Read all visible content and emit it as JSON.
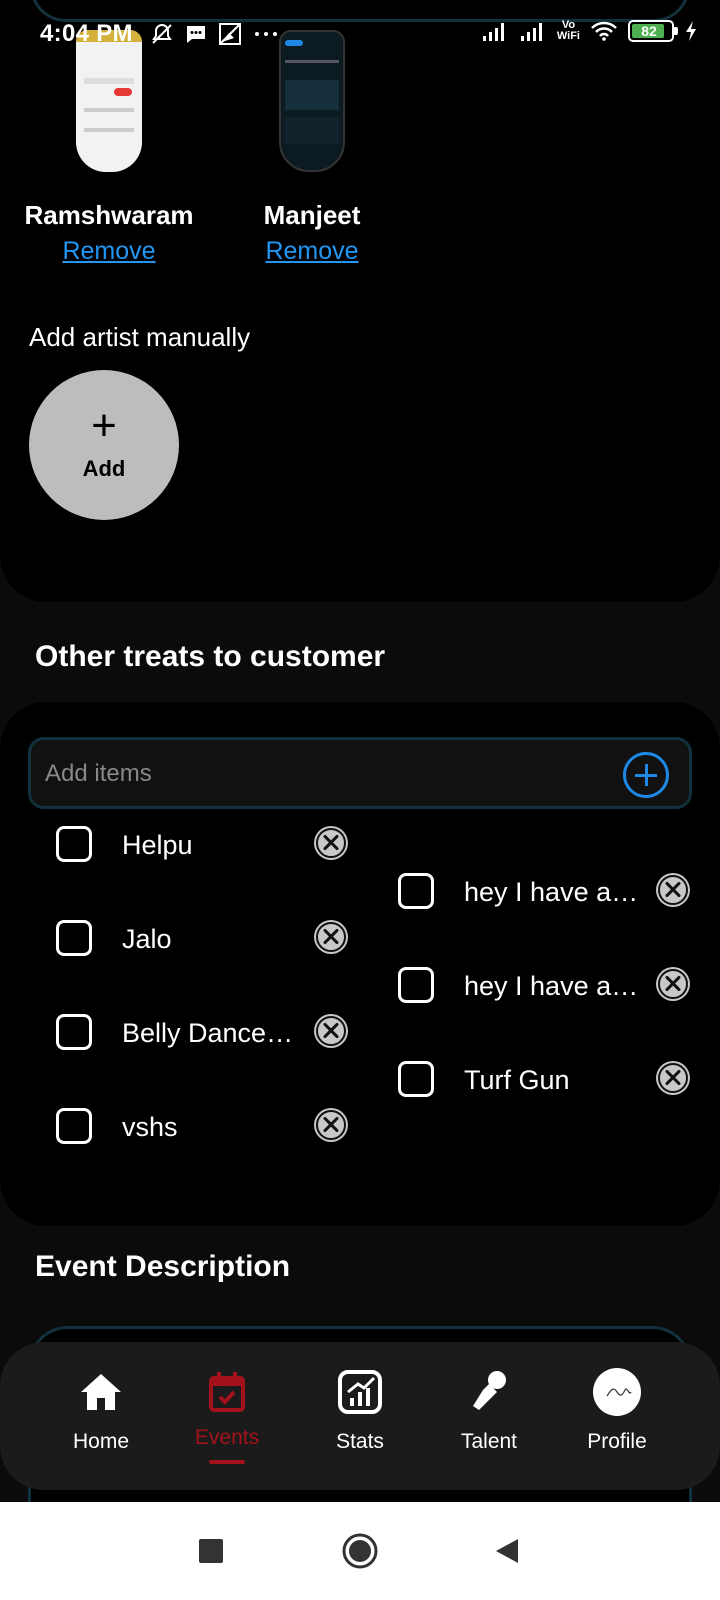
{
  "status_bar": {
    "time": "4:04 PM",
    "left_icons": [
      "mute-bell-icon",
      "message-icon",
      "gallery-icon",
      "more-dots-icon"
    ],
    "right_icons": [
      "signal-icon",
      "signal-icon",
      "vowifi-icon",
      "wifi-icon",
      "battery-icon",
      "charging-icon"
    ],
    "vowifi_label_top": "Vo",
    "vowifi_label_bottom": "WiFi",
    "battery_level": "82"
  },
  "artists": {
    "items": [
      {
        "name": "Ramshwaram",
        "remove_label": "Remove",
        "thumb": "light"
      },
      {
        "name": "Manjeet",
        "remove_label": "Remove",
        "thumb": "dark"
      }
    ],
    "add_manual_label": "Add artist manually",
    "add_button": {
      "icon": "+",
      "label": "Add"
    }
  },
  "treats": {
    "heading": "Other treats to customer",
    "input_placeholder": "Add items",
    "items": [
      {
        "label": "Helpu",
        "checked": false
      },
      {
        "label": "hey I have a long item name here",
        "checked": false
      },
      {
        "label": "Jalo",
        "checked": false
      },
      {
        "label": "hey I have a long item name here",
        "checked": false
      },
      {
        "label": "Belly Dance show",
        "checked": false
      },
      {
        "label": "Turf Gun",
        "checked": false
      },
      {
        "label": "vshs",
        "checked": false
      }
    ]
  },
  "description": {
    "heading": "Event Description"
  },
  "bottom_nav": {
    "items": [
      {
        "label": "Home",
        "icon": "home-icon",
        "active": false
      },
      {
        "label": "Events",
        "icon": "calendar-icon",
        "active": true
      },
      {
        "label": "Stats",
        "icon": "stats-icon",
        "active": false
      },
      {
        "label": "Talent",
        "icon": "microphone-icon",
        "active": false
      },
      {
        "label": "Profile",
        "icon": "avatar",
        "active": false
      }
    ]
  },
  "colors": {
    "accent_blue": "#1e88e5",
    "active_red": "#a3121a",
    "card_border": "#12313f"
  }
}
